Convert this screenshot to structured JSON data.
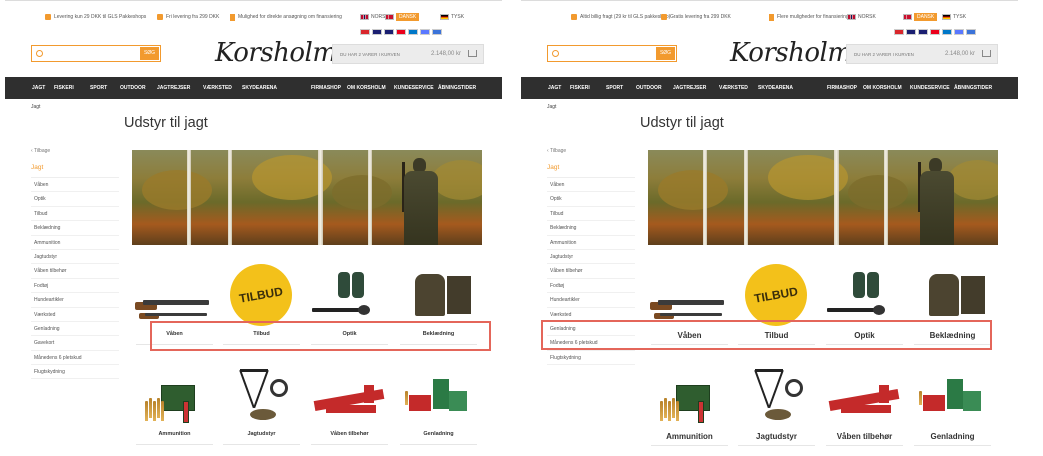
{
  "left_panel": {
    "info_bar": {
      "shipping": "Levering kun 29 DKK til GLS Pakkeshops",
      "free_delivery": "Fri levering fra 299 DKK",
      "financing": "Mulighed for direkte ansøgning om finansiering"
    },
    "languages": [
      "NORSK",
      "DANSK",
      "TYSK"
    ],
    "search": {
      "button": "SØG"
    },
    "logo": "Korsholm",
    "cart": {
      "label": "DU HAR 2 VARER I KURVEN",
      "total": "2.148,00 kr"
    },
    "nav_left": [
      "JAGT",
      "FISKERI",
      "SPORT",
      "OUTDOOR",
      "JAGTREJSER",
      "VÆRKSTED",
      "SKYDEARENA"
    ],
    "nav_right": [
      "FIRMASHOP",
      "OM KORSHOLM",
      "KUNDESERVICE",
      "ÅBNINGSTIDER"
    ],
    "breadcrumb": "Jagt",
    "page_title": "Udstyr til jagt",
    "sidebar": {
      "back": "‹ Tilbage",
      "parent": "Jagt",
      "items": [
        "Våben",
        "Optik",
        "Tilbud",
        "Beklædning",
        "Ammunition",
        "Jagtudstyr",
        "Våben tilbehør",
        "Fodtøj",
        "Hundeartikler",
        "Værksted",
        "Genladning",
        "Gavekort",
        "Månedens 6 pletskud",
        "Flugtskydning"
      ]
    },
    "products_row1": [
      "Våben",
      "Tilbud",
      "Optik",
      "Beklædning"
    ],
    "products_row2": [
      "Ammunition",
      "Jagtudstyr",
      "Våben tilbehør",
      "Genladning"
    ],
    "tilbud_badge": "TILBUD"
  },
  "right_panel": {
    "info_bar": {
      "shipping": "Altid billig fragt (29 kr til GLS pakkeshop)",
      "free_delivery": "Gratis levering fra 299 DKK",
      "financing": "Flere muligheder for finansiering"
    },
    "languages": [
      "NORSK",
      "DANSK",
      "TYSK"
    ],
    "search": {
      "button": "SØG"
    },
    "logo": "Korsholm",
    "cart": {
      "label": "DU HAR 2 VARER I KURVEN",
      "total": "2.148,00 kr"
    },
    "nav_left": [
      "JAGT",
      "FISKERI",
      "SPORT",
      "OUTDOOR",
      "JAGTREJSER",
      "VÆRKSTED",
      "SKYDEARENA"
    ],
    "nav_right": [
      "FIRMASHOP",
      "OM KORSHOLM",
      "KUNDESERVICE",
      "ÅBNINGSTIDER"
    ],
    "breadcrumb": "Jagt",
    "page_title": "Udstyr til jagt",
    "sidebar": {
      "back": "‹ Tilbage",
      "parent": "Jagt",
      "items": [
        "Våben",
        "Optik",
        "Tilbud",
        "Beklædning",
        "Ammunition",
        "Jagtudstyr",
        "Våben tilbehør",
        "Fodtøj",
        "Hundeartikler",
        "Værksted",
        "Genladning",
        "Månedens 6 pletskud",
        "Flugtskydning"
      ]
    },
    "products_row1": [
      "Våben",
      "Tilbud",
      "Optik",
      "Beklædning"
    ],
    "products_row2": [
      "Ammunition",
      "Jagtudstyr",
      "Våben tilbehør",
      "Genladning"
    ],
    "tilbud_badge": "TILBUD"
  },
  "colors": {
    "accent": "#f29a2e",
    "nav_bg": "#2f2f2f",
    "highlight": "#e4665a",
    "tilbud": "#f3c11a"
  }
}
